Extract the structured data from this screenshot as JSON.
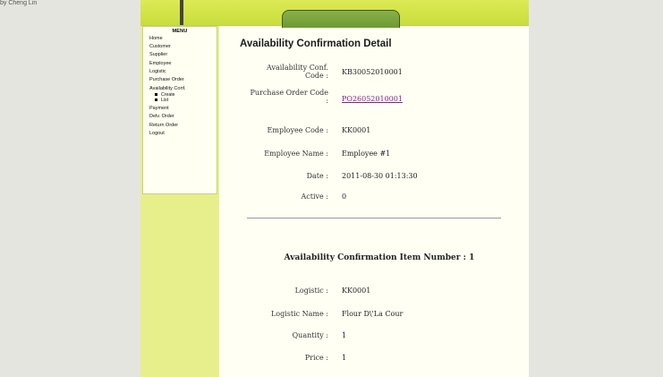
{
  "corner": "by Cheng Lin",
  "menu": {
    "title": "MENU",
    "items": [
      {
        "label": "Home"
      },
      {
        "label": "Customer"
      },
      {
        "label": "Supplier"
      },
      {
        "label": "Employee"
      },
      {
        "label": "Logistic"
      },
      {
        "label": "Purchase Order"
      },
      {
        "label": "Availability Conf."
      }
    ],
    "subitems": [
      {
        "label": "Create"
      },
      {
        "label": "List"
      }
    ],
    "items_after": [
      {
        "label": "Payment"
      },
      {
        "label": "Delv. Order"
      },
      {
        "label": "Return Order"
      },
      {
        "label": "Logout"
      }
    ]
  },
  "detail": {
    "title": "Availability Confirmation Detail",
    "fields": {
      "code_label_1": "Availability Conf.",
      "code_label_2": "Code :",
      "code_value": "KB30052010001",
      "po_label_1": "Purchase Order Code",
      "po_label_2": ":",
      "po_value": "PO26052010001",
      "emp_code_label": "Employee Code :",
      "emp_code_value": "KK0001",
      "emp_name_label": "Employee Name :",
      "emp_name_value": "Employee #1",
      "date_label": "Date :",
      "date_value": "2011-08-30 01:13:30",
      "active_label": "Active :",
      "active_value": "0"
    }
  },
  "item": {
    "heading": "Availability Confirmation Item Number : 1",
    "logistic_label": "Logistic :",
    "logistic_value": "KK0001",
    "logistic_name_label": "Logistic Name :",
    "logistic_name_value": "Flour D\\'La Cour",
    "quantity_label": "Quantity :",
    "quantity_value": "1",
    "price_label": "Price :",
    "price_value": "1"
  }
}
